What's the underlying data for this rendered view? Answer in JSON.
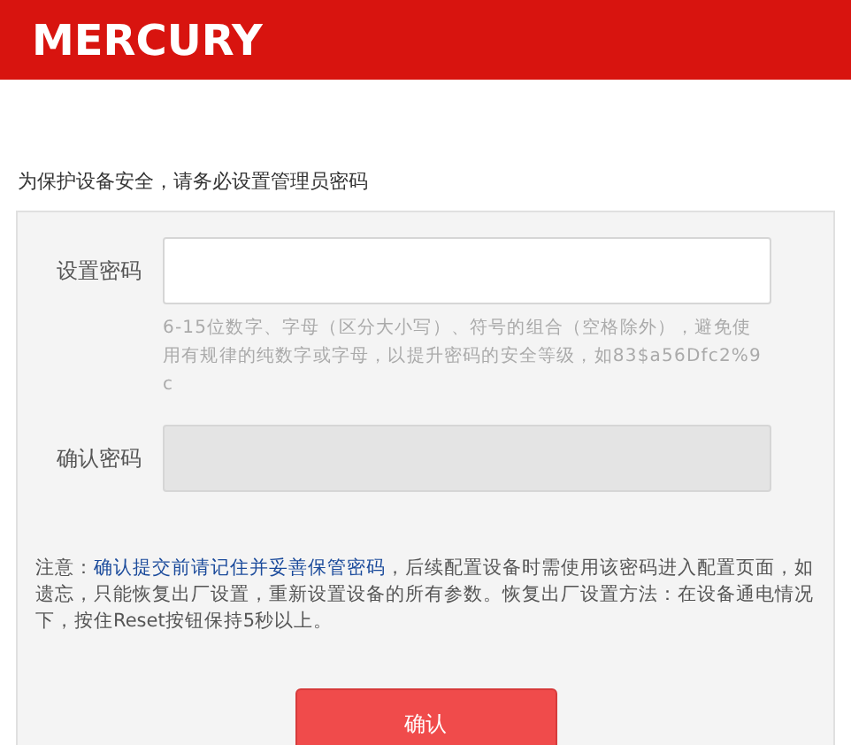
{
  "header": {
    "logo": "MERCURY"
  },
  "heading": "为保护设备安全，请务必设置管理员密码",
  "fields": [
    {
      "label": "设置密码",
      "disabled": false,
      "hint": "6-15位数字、字母（区分大小写）、符号的组合（空格除外），避免使用有规律的纯数字或字母，以提升密码的安全等级，如83$a56Dfc2%9c"
    },
    {
      "label": "确认密码",
      "disabled": true
    }
  ],
  "note": "注意：**确认提交前请记住并妥善保管密码**，后续配置设备时需使用该密码进入配置页面，如遗忘，只能恢复出厂设置，重新设置设备的所有参数。恢复出厂设置方法：在设备通电情况下，按住Reset按钮保持5秒以上。",
  "button": "确认"
}
